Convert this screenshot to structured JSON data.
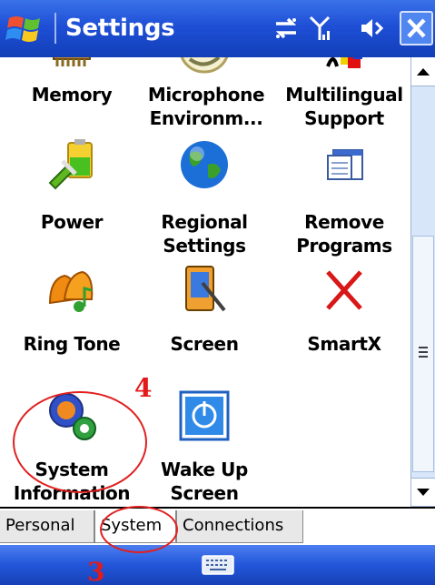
{
  "titlebar": {
    "title": "Settings"
  },
  "items": [
    {
      "label": "Memory"
    },
    {
      "label": "Microphone Environm..."
    },
    {
      "label": "Multilingual Support"
    },
    {
      "label": "Power"
    },
    {
      "label": "Regional Settings"
    },
    {
      "label": "Remove Programs"
    },
    {
      "label": "Ring Tone"
    },
    {
      "label": "Screen"
    },
    {
      "label": "SmartX"
    },
    {
      "label": "System Information"
    },
    {
      "label": "Wake Up Screen"
    }
  ],
  "tabs": [
    {
      "label": "Personal"
    },
    {
      "label": "System"
    },
    {
      "label": "Connections"
    }
  ],
  "annotations": {
    "step_3": "3",
    "step_4": "4"
  },
  "colors": {
    "titlebar": "#1e4fd6",
    "annotation": "#e31a1a"
  }
}
